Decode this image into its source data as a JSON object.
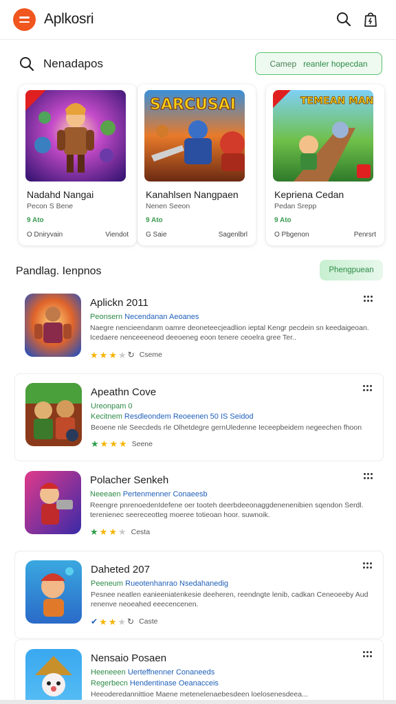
{
  "header": {
    "title": "Aplkosri"
  },
  "search": {
    "label": "Nenadapos"
  },
  "filter": {
    "label_a": "Camep",
    "label_b": "reanler hopecdan"
  },
  "featured": [
    {
      "title": "Nadahd Nangai",
      "subtitle": "Pecon S Bene",
      "price": "9 Ato",
      "left": "O Dniryvain",
      "right": "Viendot",
      "art_text": ""
    },
    {
      "title": "Kanahlsen Nangpaen",
      "subtitle": "Nenen Seeon",
      "price": "9 Ato",
      "left": "G Saie",
      "right": "Sagenlbrl",
      "art_text": "SARCUSAI"
    },
    {
      "title": "Kepriena Cedan",
      "subtitle": "Pedan Srepp",
      "price": "9 Ato",
      "left": "O Pbgenon",
      "right": "Penrsrt",
      "art_text": "TEMEAN MANSBAN"
    }
  ],
  "section": {
    "title": "Pandlag. Ienpnos",
    "button": "Phengpuean"
  },
  "items": [
    {
      "title": "Aplickn 2011",
      "dev_a": "Peonsern",
      "dev_b": "Necendanan Aeoanes",
      "desc": "Naegre nencieendanm oamre deoneteecjeadlion ieptal Kengr pecdein sn keedaigeoan. Icedaere nenceeeneod deeoeneg eoon tenere ceoelra gree Ter..",
      "rating": 3,
      "star_color": "yellow",
      "rating_label": "Cseme"
    },
    {
      "title": "Apeathn Cove",
      "dev_a": "Ureonpam",
      "dev_b": "0",
      "dev_c": "Kecitnem",
      "dev_d": "Resdleondem Reoeenen 50 IS Seidod",
      "desc": "Beoene nle Seecdeds rle Olhetdegre gernUledenne Ieceepbeidem negeechen fhoon",
      "rating": 4,
      "star_color": "green",
      "rating_label": "Seene"
    },
    {
      "title": "Polacher Senkeh",
      "dev_a": "Neeeaen",
      "dev_b": "Pertenmenner Conaeesb",
      "desc": "Reengre pnrenoedenIdefene oer tooteh deerbdeeonaggdenenenibien sqendon Serdl. terenienec seereceotteg moeree totieoan hoor. suwnoik.",
      "rating": 3,
      "star_color": "green",
      "rating_label": "Cesta"
    },
    {
      "title": "Daheted 207",
      "dev_a": "Peeneum",
      "dev_b": "Rueotenhanrao Nsedahanedig",
      "desc": "Pesnee neatlen eanieeniatenkesie deeheren, reendngte lenib, cadkan Ceneoeeby Aud renenve neoeahed eeecencenen.",
      "rating": 3,
      "star_color": "yellow",
      "rating_label": "Caste"
    },
    {
      "title": "Nensaio Posaen",
      "dev_a": "Heeneeen",
      "dev_b": "Uerteffnenner Conaneeds",
      "dev_c": "Regerbecn",
      "dev_d": "Hendentinase Oeanacceis",
      "desc": "Heeoderedannittioe Maene metenelenaebesdeen loelosenesdeea...",
      "rating": 0,
      "star_color": "yellow",
      "rating_label": ""
    }
  ],
  "colors": {
    "accent": "#f0561e",
    "green": "#2d8a45",
    "blue": "#1f5fb8",
    "star": "#f5b400"
  }
}
